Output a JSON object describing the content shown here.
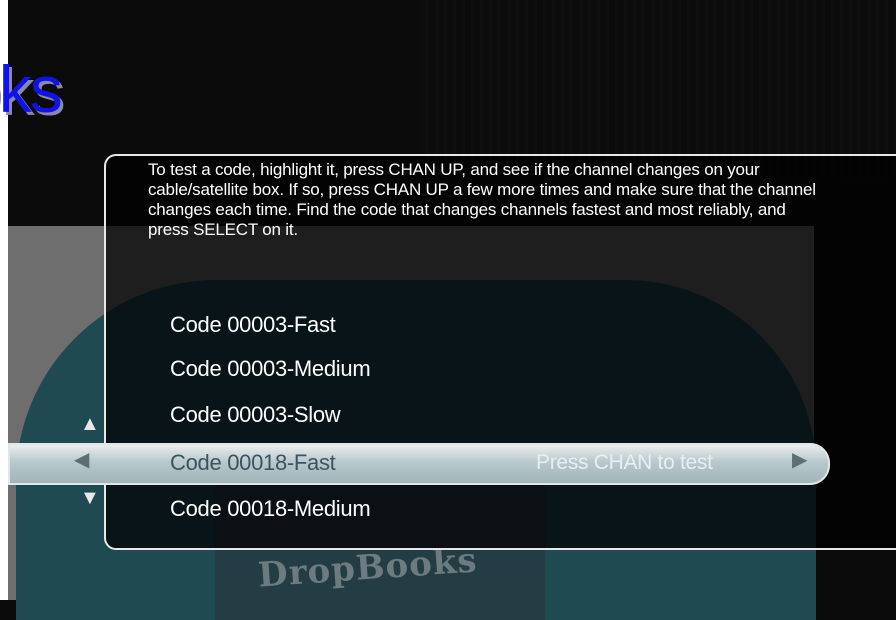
{
  "app_title": "oks",
  "instructions": "To test a code, highlight it, press CHAN UP, and see if the channel changes on your cable/satellite box.  If so, press CHAN UP a few more times and make sure that the channel changes each time.  Find the code that changes channels fastest and most reliably, and press SELECT on it.",
  "codes": [
    {
      "label": "Code 00003-Fast"
    },
    {
      "label": "Code 00003-Medium"
    },
    {
      "label": "Code 00003-Slow"
    },
    {
      "label": "Code 00018-Fast"
    },
    {
      "label": "Code 00018-Medium"
    }
  ],
  "selected_index": 3,
  "selected_hint": "Press CHAN to test",
  "watermark": "DropBooks",
  "icons": {
    "scroll_up": "triangle-up-icon",
    "scroll_down": "triangle-down-icon",
    "nav_left": "triangle-left-icon",
    "nav_right": "triangle-right-icon"
  },
  "colors": {
    "title": "#1212e6",
    "background": "#0b0b0b",
    "selection_bar": "#b8c8cc"
  }
}
